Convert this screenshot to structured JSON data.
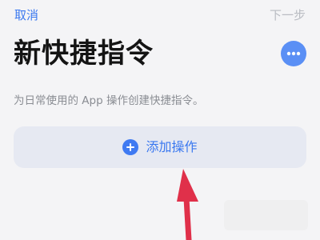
{
  "nav": {
    "cancel_label": "取消",
    "next_label": "下一步"
  },
  "header": {
    "title": "新快捷指令",
    "more_icon": "ellipsis-icon"
  },
  "main": {
    "description": "为日常使用的 App 操作创建快捷指令。",
    "add_action": {
      "icon": "plus-circle-icon",
      "label": "添加操作"
    }
  },
  "colors": {
    "accent": "#3a78f0",
    "disabled": "#b9bcc2",
    "annotation_arrow": "#e0304a"
  }
}
